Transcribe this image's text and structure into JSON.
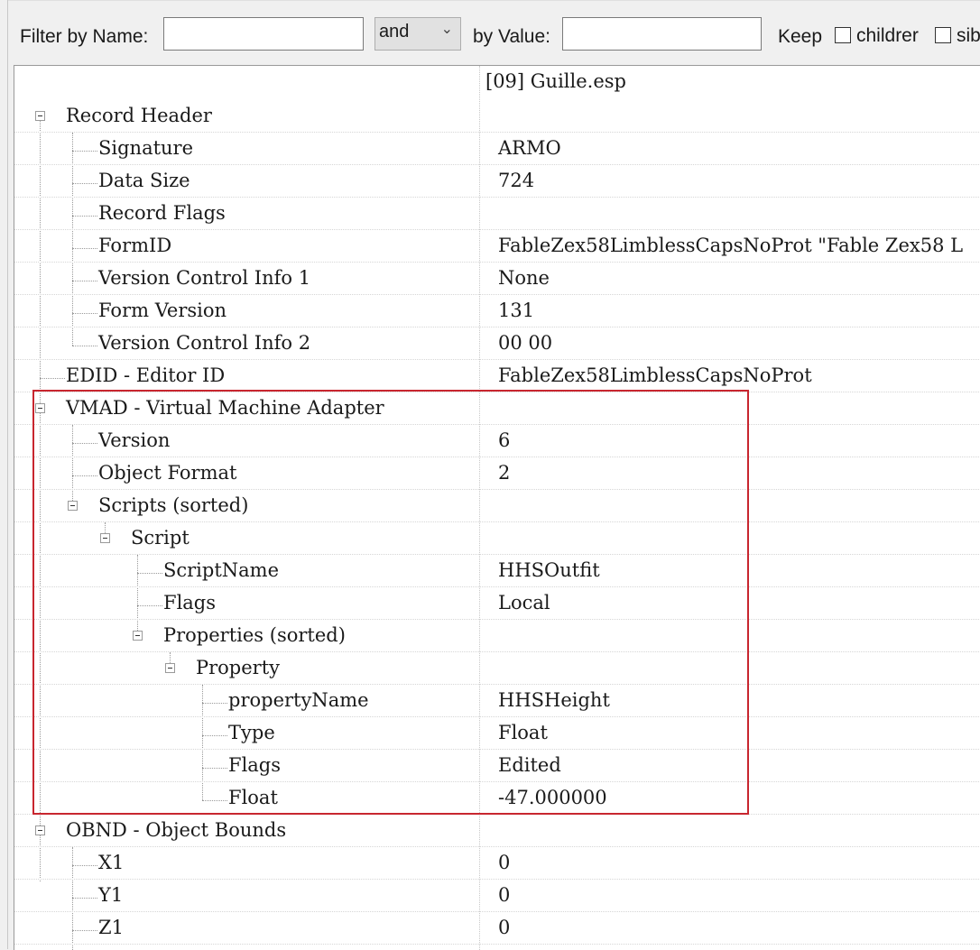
{
  "filter": {
    "name_label": "Filter by Name:",
    "name_value": "",
    "logic": "and",
    "value_label": "by Value:",
    "value_value": "",
    "keep_label": "Keep",
    "children_label": "childrer",
    "siblings_label": "sib"
  },
  "tree": {
    "column_header": "[09] Guille.esp",
    "rows": [
      {
        "label": "Record Header",
        "value": ""
      },
      {
        "label": "Signature",
        "value": "ARMO"
      },
      {
        "label": "Data Size",
        "value": "724"
      },
      {
        "label": "Record Flags",
        "value": ""
      },
      {
        "label": "FormID",
        "value": "FableZex58LimblessCapsNoProt \"Fable Zex58 L"
      },
      {
        "label": "Version Control Info 1",
        "value": "None"
      },
      {
        "label": "Form Version",
        "value": "131"
      },
      {
        "label": "Version Control Info 2",
        "value": "00 00"
      },
      {
        "label": "EDID - Editor ID",
        "value": "FableZex58LimblessCapsNoProt"
      },
      {
        "label": "VMAD - Virtual Machine Adapter",
        "value": ""
      },
      {
        "label": "Version",
        "value": "6"
      },
      {
        "label": "Object Format",
        "value": "2"
      },
      {
        "label": "Scripts (sorted)",
        "value": ""
      },
      {
        "label": "Script",
        "value": ""
      },
      {
        "label": "ScriptName",
        "value": "HHSOutfit"
      },
      {
        "label": "Flags",
        "value": "Local"
      },
      {
        "label": "Properties (sorted)",
        "value": ""
      },
      {
        "label": "Property",
        "value": ""
      },
      {
        "label": "propertyName",
        "value": "HHSHeight"
      },
      {
        "label": "Type",
        "value": "Float"
      },
      {
        "label": "Flags",
        "value": "Edited"
      },
      {
        "label": "Float",
        "value": "-47.000000"
      },
      {
        "label": "OBND - Object Bounds",
        "value": ""
      },
      {
        "label": "X1",
        "value": "0"
      },
      {
        "label": "Y1",
        "value": "0"
      },
      {
        "label": "Z1",
        "value": "0"
      }
    ]
  },
  "colors": {
    "highlight": "#c8262f",
    "tree_background": "#ffffff",
    "toolbar_background": "#f0f0f0"
  }
}
